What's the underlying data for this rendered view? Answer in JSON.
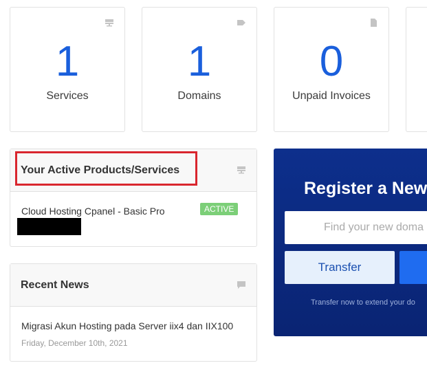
{
  "stats": [
    {
      "value": "1",
      "label": "Services",
      "icon": "server-icon"
    },
    {
      "value": "1",
      "label": "Domains",
      "icon": "tag-icon"
    },
    {
      "value": "0",
      "label": "Unpaid Invoices",
      "icon": "document-icon"
    }
  ],
  "products_panel": {
    "title": "Your Active Products/Services",
    "icon": "server-icon",
    "items": [
      {
        "name": "Cloud Hosting Cpanel - Basic Pro",
        "status": "ACTIVE"
      }
    ]
  },
  "news_panel": {
    "title": "Recent News",
    "icon": "comment-icon",
    "items": [
      {
        "title": "Migrasi Akun Hosting pada Server iix4 dan IIX100",
        "date": "Friday, December 10th, 2021"
      }
    ]
  },
  "domain_panel": {
    "title": "Register a New",
    "search_placeholder": "Find your new doma",
    "transfer_label": "Transfer",
    "hint": "Transfer now to extend your do"
  },
  "colors": {
    "accent": "#1a5fdc",
    "active_badge": "#7ccf78",
    "domain_bg": "#0d2f8c",
    "highlight": "#d9262e"
  }
}
